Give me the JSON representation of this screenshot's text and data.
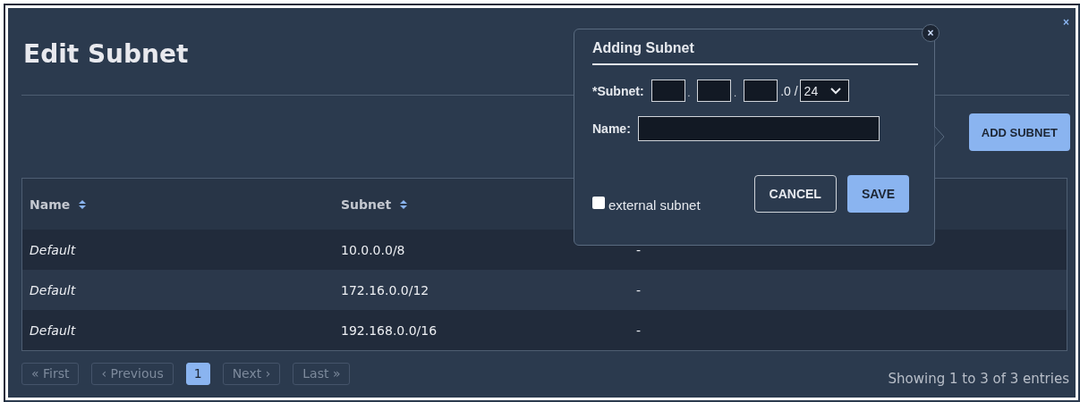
{
  "title": "Edit Subnet",
  "close_label": "×",
  "add_button": "ADD SUBNET",
  "table": {
    "columns": [
      {
        "label": "Name"
      },
      {
        "label": "Subnet"
      }
    ],
    "rows": [
      {
        "name": "Default",
        "subnet": "10.0.0.0/8",
        "column_3": "-"
      },
      {
        "name": "Default",
        "subnet": "172.16.0.0/12",
        "column_3": "-"
      },
      {
        "name": "Default",
        "subnet": "192.168.0.0/16",
        "column_3": "-"
      }
    ]
  },
  "pagination": [
    {
      "label": "« First",
      "selected": false,
      "disabled": true
    },
    {
      "label": "‹ Previous",
      "selected": false,
      "disabled": true
    },
    {
      "label": "1",
      "selected": true,
      "disabled": false
    },
    {
      "label": "Next ›",
      "selected": false,
      "disabled": true
    },
    {
      "label": "Last »",
      "selected": false,
      "disabled": true
    }
  ],
  "info": "Showing 1 to 3 of 3 entries",
  "popover": {
    "title": "Adding Subnet",
    "close_label": "×",
    "subnet_label": "*Subnet:",
    "dot": ".",
    "suffix": ".0 /",
    "prefix_value": "24",
    "name_label": "Name:",
    "external": {
      "label": "external subnet",
      "checked": false
    },
    "buttons": [
      {
        "label": "CANCEL",
        "kind": "secondary"
      },
      {
        "label": "SAVE",
        "kind": "primary"
      }
    ]
  }
}
